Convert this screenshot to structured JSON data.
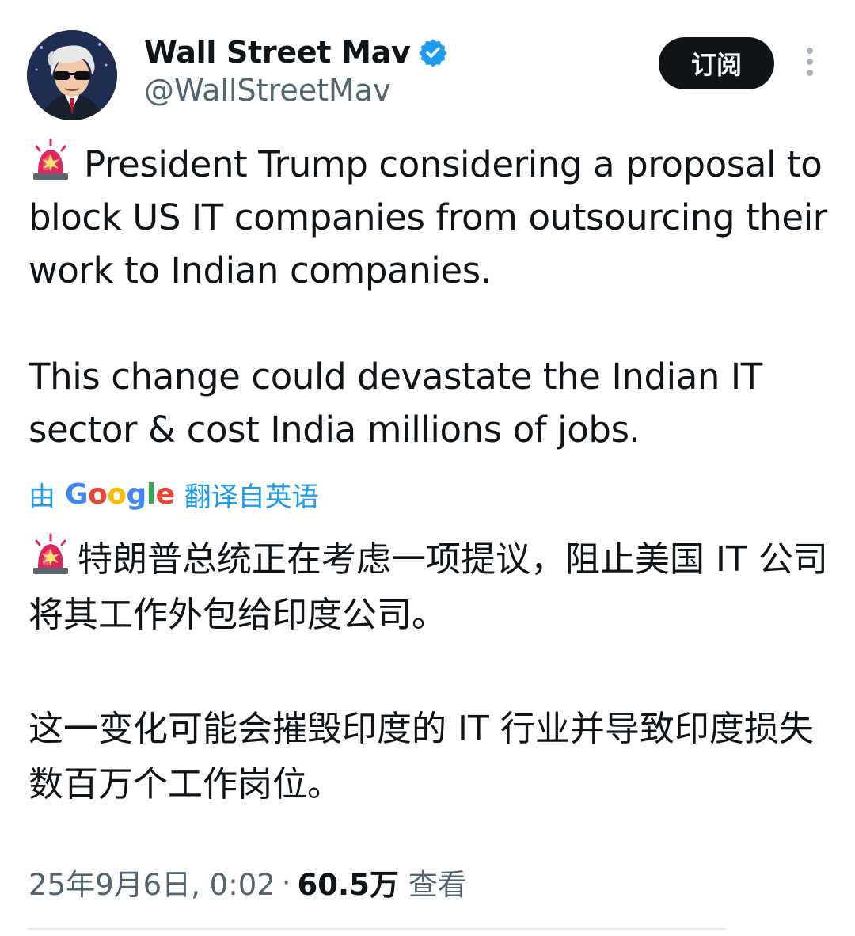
{
  "author": {
    "display_name": "Wall Street Mav",
    "handle": "@WallStreetMav",
    "verified_icon": "verified-badge-icon"
  },
  "actions": {
    "subscribe_label": "订阅",
    "more_icon": "more-vertical-icon"
  },
  "tweet": {
    "en_paragraph_1": "President Trump considering a proposal to block US IT companies from outsourcing their work to Indian companies.",
    "en_paragraph_2": "This change could devastate the Indian IT sector & cost India millions of jobs.",
    "translation_prefix": "由",
    "translation_provider": "Google",
    "translation_suffix": "翻译自英语",
    "zh_paragraph_1": "特朗普总统正在考虑一项提议，阻止美国 IT 公司将其工作外包给印度公司。",
    "zh_paragraph_2": "这一变化可能会摧毁印度的 IT 行业并导致印度损失数百万个工作岗位。"
  },
  "meta": {
    "timestamp": "25年9月6日, 0:02",
    "separator": "·",
    "views_count": "60.5万",
    "views_label": "查看"
  },
  "colors": {
    "text_primary": "#0f1419",
    "text_secondary": "#536471",
    "link_blue": "#1d9bf0",
    "verified_blue": "#1d9bf0",
    "button_dark": "#0f1419"
  }
}
